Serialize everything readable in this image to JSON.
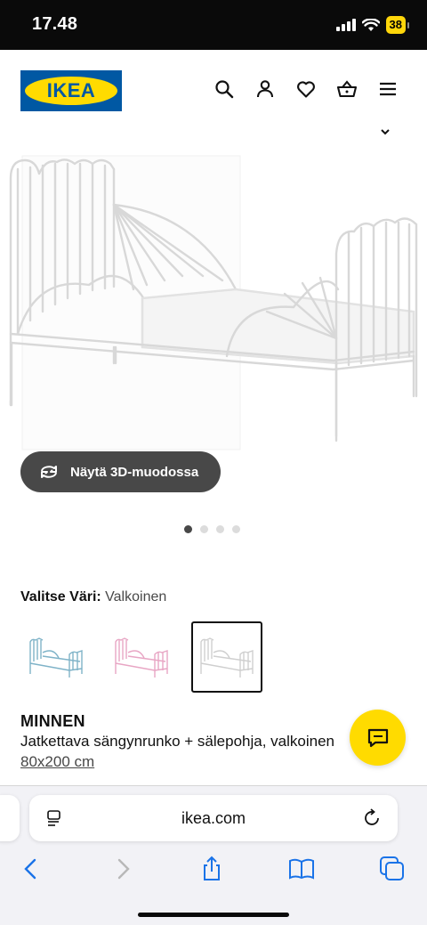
{
  "status_bar": {
    "time": "17.48",
    "battery": "38"
  },
  "header": {
    "logo_text": "IKEA",
    "icons": [
      "search-icon",
      "user-icon",
      "heart-icon",
      "basket-icon",
      "menu-icon"
    ]
  },
  "gallery": {
    "view_3d_label": "Näytä 3D-muodossa",
    "image_count": 4,
    "active_index": 0
  },
  "color_selector": {
    "label": "Valitse Väri:",
    "selected_value": "Valkoinen",
    "swatches": [
      {
        "name": "light-blue",
        "color": "#7fb3c8",
        "selected": false
      },
      {
        "name": "pink",
        "color": "#e8a6c4",
        "selected": false
      },
      {
        "name": "white",
        "color": "#d9d9d9",
        "selected": true
      }
    ]
  },
  "product": {
    "name": "MINNEN",
    "description": "Jatkettava sängynrunko + sälepohja, valkoinen",
    "size": "80x200 cm"
  },
  "browser": {
    "url": "ikea.com"
  },
  "colors": {
    "ikea_blue": "#0058a3",
    "ikea_yellow": "#ffdb00",
    "dark_button": "#484848"
  }
}
